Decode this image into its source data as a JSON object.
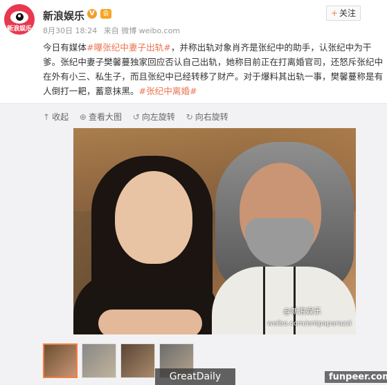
{
  "account": {
    "name": "新浪娱乐",
    "avatar_text": "新浪娱乐",
    "verified_badge": "V",
    "member_badge": "会",
    "date": "8月30日 18:24",
    "source": "来自 微博 weibo.com"
  },
  "follow_button": {
    "plus": "+",
    "label": "关注"
  },
  "post": {
    "text_1": "今日有媒体",
    "hashtag_1": "#曝张纪中妻子出轨#",
    "text_2": "，并称出轨对象肖齐是张纪中的助手，认张纪中为干爹。张纪中妻子樊馨蔓独家回应否认自己出轨，她称目前正在打离婚官司，还怒斥张纪中在外有小三、私生子，而且张纪中已经转移了财产。对于爆料其出轨一事，樊馨蔓称是有人倒打一耙，蓄意抹黑。",
    "hashtag_2": "#张纪中离婚#"
  },
  "toolbar": [
    {
      "icon": "collapse-icon",
      "glyph": "↑",
      "label": "收起"
    },
    {
      "icon": "zoom-icon",
      "glyph": "⊕",
      "label": "查看大图"
    },
    {
      "icon": "rotate-left-icon",
      "glyph": "↺",
      "label": "向左旋转"
    },
    {
      "icon": "rotate-right-icon",
      "glyph": "↻",
      "label": "向右旋转"
    }
  ],
  "photo": {
    "watermark_1": "@新浪娱乐",
    "watermark_2": "weibo.com/entpaparazzi"
  },
  "thumbnails": {
    "count": 4,
    "active_index": 0
  },
  "overlays": {
    "greatdaily": "GreatDaily",
    "funpeer": "funpeer.com"
  },
  "colors": {
    "link": "#eb7350",
    "accent": "#f77c3d",
    "brand_red": "#e8384f"
  }
}
